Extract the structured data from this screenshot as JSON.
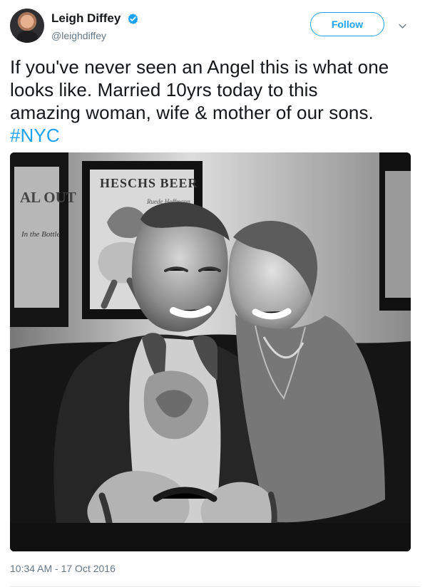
{
  "author": {
    "display_name": "Leigh Diffey",
    "handle": "@leighdiffey",
    "verified": true
  },
  "actions": {
    "follow_label": "Follow",
    "caret_icon": "chevron-down-icon"
  },
  "tweet": {
    "text": "If you've never seen an Angel this is what one\nlooks like. Married 10yrs today to this\namazing woman, wife & mother of our sons.",
    "hashtag": "#NYC",
    "timestamp": "10:34 AM - 17 Oct 2016"
  },
  "photo": {
    "poster_text": "HESCHS BEER",
    "poster_subtitle": "Ruede Hoffmann",
    "left_sign_text": "AL OUT",
    "left_sign_script": "In the Bottle"
  },
  "colors": {
    "accent": "#1da1f2",
    "text": "#14171a",
    "muted": "#657786"
  }
}
